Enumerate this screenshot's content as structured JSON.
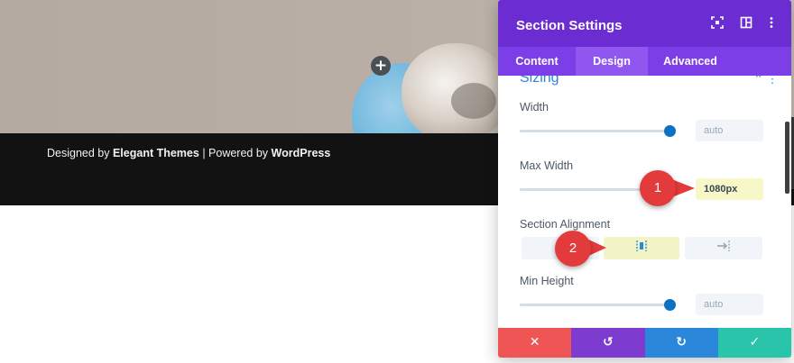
{
  "page": {
    "footer_parts": {
      "designed_by": "Designed by ",
      "elegant_themes": "Elegant Themes",
      "separator": " | Powered by ",
      "wordpress": "WordPress"
    },
    "add_button_glyph": "+"
  },
  "panel": {
    "title": "Section Settings",
    "header_icons": [
      "fullscreen-icon",
      "layout-columns-icon",
      "more-vertical-icon"
    ],
    "tabs": [
      {
        "label": "Content",
        "active": false
      },
      {
        "label": "Design",
        "active": true
      },
      {
        "label": "Advanced",
        "active": false
      }
    ],
    "group": {
      "title": "Sizing",
      "controls_glyph": "⌃  ⋮"
    },
    "fields": {
      "width": {
        "label": "Width",
        "value": "auto",
        "slider_fraction": 1.0
      },
      "max_width": {
        "label": "Max Width",
        "value": "1080px",
        "highlighted": true
      },
      "section_alignment": {
        "label": "Section Alignment",
        "options": [
          {
            "name": "left",
            "glyph": ""
          },
          {
            "name": "center",
            "glyph": "|¦|",
            "active": true
          },
          {
            "name": "right",
            "glyph": "→|"
          }
        ]
      },
      "min_height": {
        "label": "Min Height",
        "value": "auto",
        "slider_fraction": 1.0
      }
    },
    "footer_buttons": [
      {
        "name": "discard",
        "glyph": "✕",
        "color": "#ef5555"
      },
      {
        "name": "undo",
        "glyph": "↺",
        "color": "#7e3bd0"
      },
      {
        "name": "redo",
        "glyph": "↻",
        "color": "#2b87da"
      },
      {
        "name": "save",
        "glyph": "✓",
        "color": "#29c4a9"
      }
    ]
  },
  "markers": [
    {
      "number": "1"
    },
    {
      "number": "2"
    }
  ],
  "colors": {
    "header_purple": "#6b2cd1",
    "tabs_purple": "#7c3ee6",
    "accent_blue": "#2b87da",
    "marker_red": "#e33b3b",
    "highlight_yellow": "#f7f7c8"
  }
}
